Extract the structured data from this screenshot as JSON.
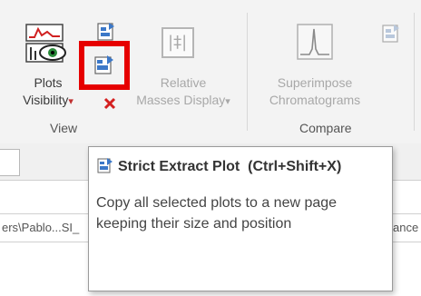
{
  "ribbon": {
    "plots_visibility": {
      "line1": "Plots",
      "line2": "Visibility",
      "arrow": "▾"
    },
    "relative_masses": {
      "line1": "Relative",
      "line2": "Masses Display",
      "arrow": "▾"
    },
    "superimpose": {
      "line1": "Superimpose",
      "line2": "Chromatograms"
    },
    "groups": {
      "view": "View",
      "compare": "Compare"
    },
    "relative_icon_text": "|‡|"
  },
  "document": {
    "path_left": "ers\\Pablo...SI_",
    "path_right": "ance"
  },
  "tooltip": {
    "title": "Strict Extract Plot",
    "shortcut": "(Ctrl+Shift+X)",
    "description": "Copy all selected plots to a new page keeping their size and position"
  },
  "colors": {
    "highlight": "#e60000",
    "delete_x": "#d42020",
    "icon_blue": "#3c78c8"
  }
}
